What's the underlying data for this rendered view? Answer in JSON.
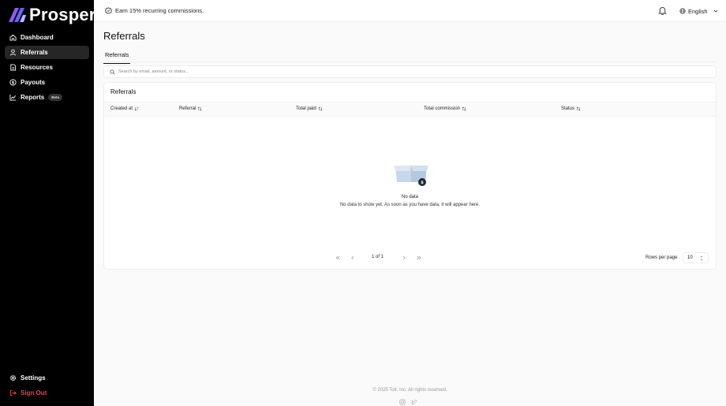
{
  "brand": {
    "name": "Prosperna",
    "accent": "#7c5cff"
  },
  "sidebar": {
    "items": [
      {
        "label": "Dashboard",
        "icon": "home-icon"
      },
      {
        "label": "Referrals",
        "icon": "user-icon",
        "active": true
      },
      {
        "label": "Resources",
        "icon": "file-icon"
      },
      {
        "label": "Payouts",
        "icon": "dollar-circle-icon"
      },
      {
        "label": "Reports",
        "icon": "chart-line-icon",
        "badge": "Beta"
      }
    ],
    "bottom": [
      {
        "label": "Settings",
        "icon": "gear-icon"
      },
      {
        "label": "Sign Out",
        "icon": "sign-out-icon",
        "color": "#ef4444"
      }
    ]
  },
  "topbar": {
    "promo": "Earn 15% recurring commissions.",
    "language": "English"
  },
  "page": {
    "title": "Referrals",
    "tab": "Referrals",
    "search_placeholder": "Search by email, amount, or status..."
  },
  "table": {
    "title": "Referrals",
    "columns": [
      "Created at",
      "Referral",
      "Total paid",
      "Total commission",
      "Status"
    ],
    "empty_title": "No data",
    "empty_message": "No data to show yet. As soon as you have data, it will appear here."
  },
  "pagination": {
    "page_count": "1 of 1",
    "rows_label": "Rows per page",
    "rows_value": "10"
  },
  "footer": {
    "copyright": "© 2025 Tolt, Inc. All rights reserved."
  }
}
